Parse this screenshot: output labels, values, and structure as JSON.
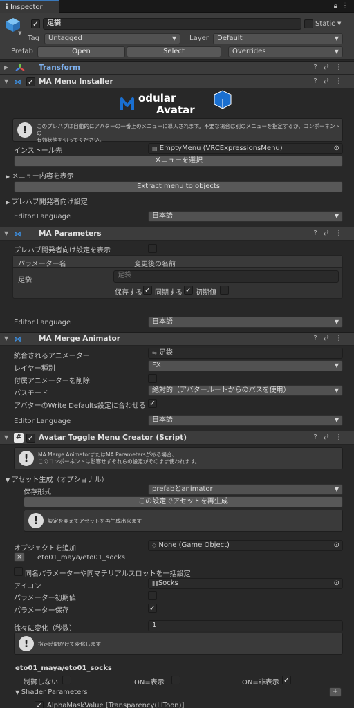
{
  "window": {
    "tab_label": "Inspector"
  },
  "header": {
    "object_name": "足袋",
    "static_label": "Static",
    "tag_label": "Tag",
    "tag_value": "Untagged",
    "layer_label": "Layer",
    "layer_value": "Default",
    "prefab_label": "Prefab",
    "open_label": "Open",
    "select_label": "Select",
    "overrides_label": "Overrides"
  },
  "transform": {
    "title": "Transform"
  },
  "menu_installer": {
    "title": "MA Menu Installer",
    "logo_top": "odular",
    "logo_bottom": "Avatar",
    "logo_m": "M",
    "help_line1": "このプレハブは自動的にアバターの一番上のメニューに導入されます。不要な場合は別のメニューを指定するか、コンポーネントの",
    "help_line2": "有効状態を切ってください。",
    "install_to_label": "インストール先",
    "install_to_value": "EmptyMenu (VRCExpressionsMenu)",
    "select_menu_button": "メニューを選択",
    "show_menu_contents": "メニュー内容を表示",
    "extract_button": "Extract menu to objects",
    "prefab_dev_settings": "プレハブ開発者向け設定",
    "editor_language_label": "Editor Language",
    "editor_language_value": "日本語"
  },
  "parameters": {
    "title": "MA Parameters",
    "show_dev_settings": "プレハブ開発者向け設定を表示",
    "col_param_name": "パラメーター名",
    "col_renamed": "変更後の名前",
    "param_name": "足袋",
    "renamed_placeholder": "足袋",
    "save_label": "保存する",
    "sync_label": "同期する",
    "default_label": "初期値",
    "save_checked": true,
    "sync_checked": true,
    "default_checked": false,
    "editor_language_label": "Editor Language",
    "editor_language_value": "日本語"
  },
  "merge_animator": {
    "title": "MA Merge Animator",
    "animator_label": "統合されるアニメーター",
    "animator_value": "足袋",
    "layer_type_label": "レイヤー種別",
    "layer_type_value": "FX",
    "delete_attached_label": "付属アニメーターを削除",
    "path_mode_label": "パスモード",
    "path_mode_value": "絶対的（アバタールートからのパスを使用）",
    "write_defaults_label": "アバターのWrite Defaults設定に合わせる",
    "editor_language_label": "Editor Language",
    "editor_language_value": "日本語"
  },
  "toggle_creator": {
    "title": "Avatar Toggle Menu Creator (Script)",
    "help_line1": "MA Merge AnimatorまたはMA Parametersがある場合、",
    "help_line2": "このコンポーネントは影響せずそれらの設定がそのまま使われます。",
    "asset_gen_label": "アセット生成（オプショナル）",
    "save_format_label": "保存形式",
    "save_format_value": "prefabとanimator",
    "regenerate_button": "この設定でアセットを再生成",
    "regen_help": "設定を変えてアセットを再生成出来ます",
    "add_object_label": "オブジェクトを追加",
    "add_object_value": "None (Game Object)",
    "object_path": "eto01_maya/eto01_socks",
    "remove_symbol": "×",
    "batch_label": "同名パラメーターや同マテリアルスロットを一括設定",
    "icon_label": "アイコン",
    "icon_value": "Socks",
    "param_default_label": "パラメーター初期値",
    "param_save_label": "パラメーター保存",
    "gradual_label": "徐々に変化（秒数）",
    "gradual_value": "1",
    "gradual_help": "指定時間かけて変化します",
    "section_title": "eto01_maya/eto01_socks",
    "no_control_label": "制御しない",
    "on_show_label": "ON=表示",
    "on_hide_label": "ON=非表示",
    "shader_params_label": "Shader Parameters",
    "plus_symbol": "+",
    "alpha_row": "AlphaMaskValue [Transparency(lilToon)]"
  },
  "colors": {
    "accent": "#3a79bb",
    "link_blue": "#7fb2f0",
    "bg": "#282828",
    "header": "#3c3c3c",
    "logo_blue": "#1a6fd0"
  }
}
